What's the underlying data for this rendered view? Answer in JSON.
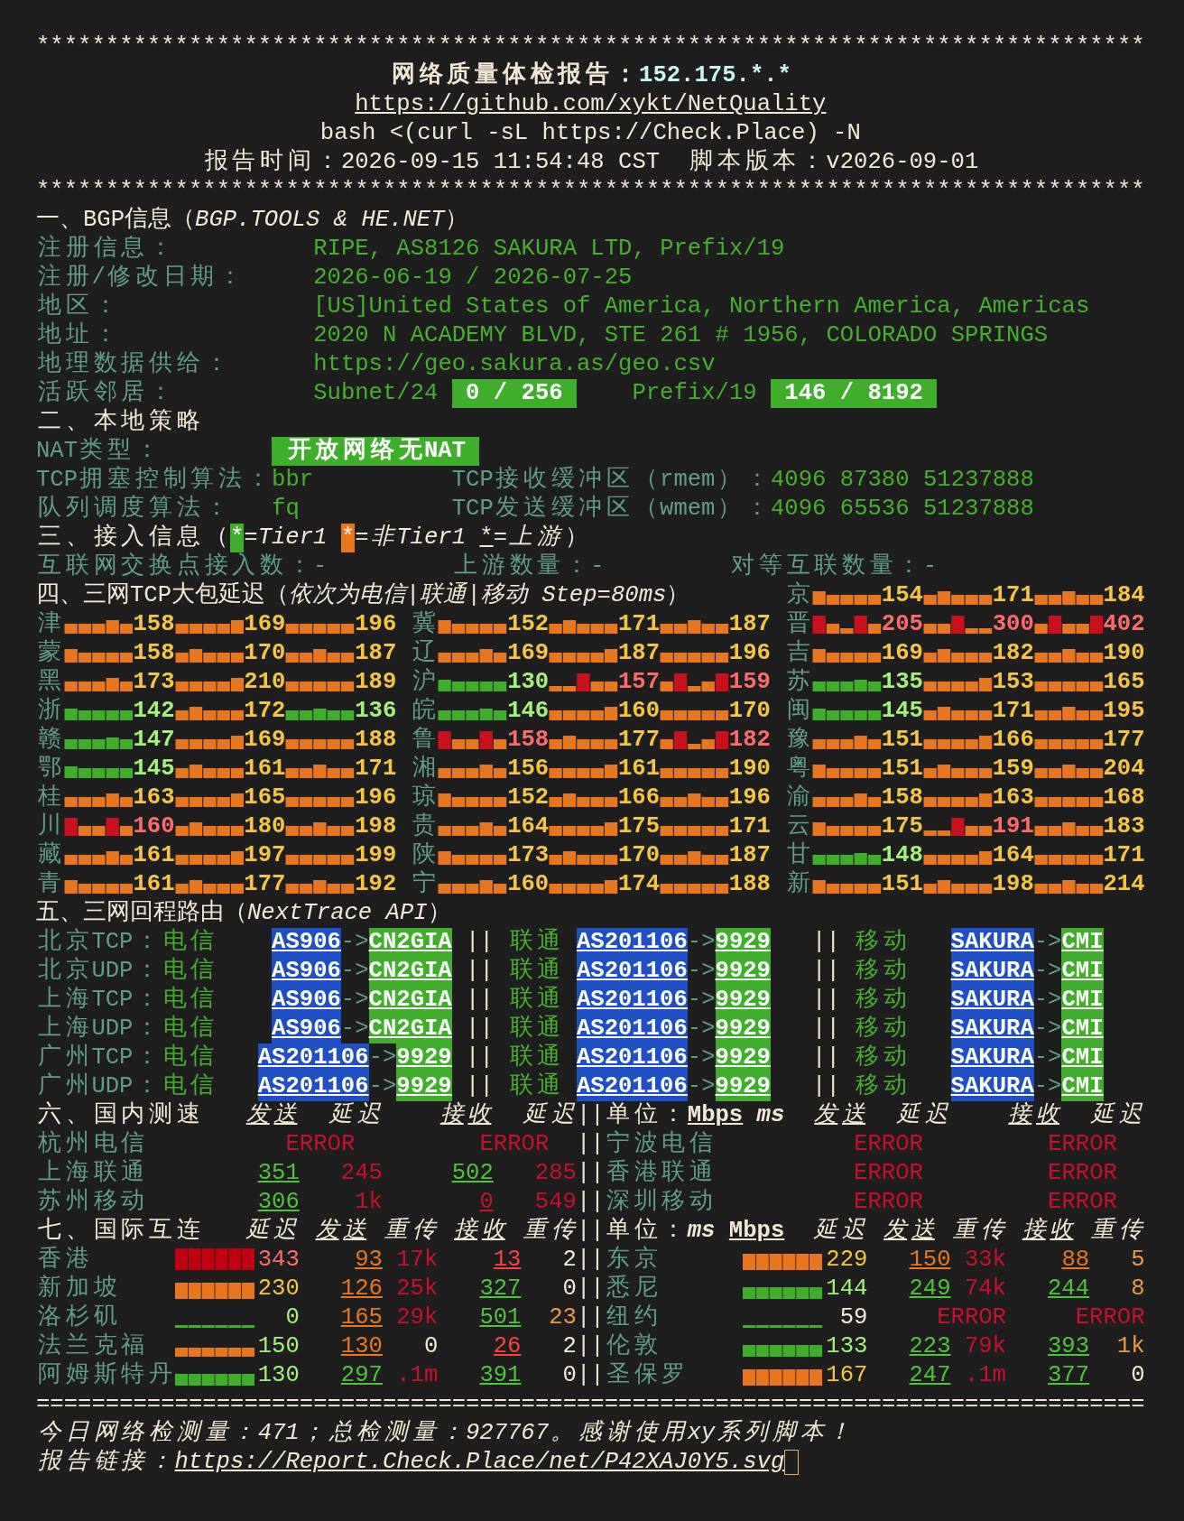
{
  "header": {
    "rule_top": "********************************************************************************",
    "title": "网络质量体检报告：",
    "ip": "152.175.*.*",
    "repo_link": "https://github.com/xykt/NetQuality",
    "command": "bash <(curl -sL https://Check.Place) -N",
    "time_label": "报告时间：",
    "time": "2026-09-15 11:54:48 CST",
    "version_label": "脚本版本：",
    "version": "v2026-09-01",
    "rule_bottom": "********************************************************************************"
  },
  "bgp": {
    "heading": "一、BGP信息（*BGP.TOOLS & HE.NET*）",
    "rows": [
      {
        "label": "注册信息：",
        "value": "RIPE, AS8126 SAKURA LTD, Prefix/19"
      },
      {
        "label": "注册/修改日期：",
        "value": "2026-06-19 / 2026-07-25"
      },
      {
        "label": "地区：",
        "value": "[US]United States of America, Northern America, Americas"
      },
      {
        "label": "地址：",
        "value": "2020 N ACADEMY BLVD, STE 261 # 1956, COLORADO SPRINGS"
      },
      {
        "label": "地理数据供给：",
        "value": "https://geo.sakura.as/geo.csv"
      }
    ],
    "neighbors": {
      "label": "活跃邻居：",
      "subnet_label": "Subnet/24",
      "subnet": "0 / 256",
      "prefix_label": "Prefix/19",
      "prefix": "146 / 8192"
    }
  },
  "local_policy": {
    "heading": "二、本地策略",
    "nat": {
      "label": "NAT类型：",
      "value": "开放网络无NAT"
    },
    "rows": [
      {
        "label": "TCP拥塞控制算法：",
        "value": "bbr",
        "buffer_label": "TCP接收缓冲区（rmem）：",
        "buffer": "4096 87380 51237888"
      },
      {
        "label": "队列调度算法：",
        "value": "fq",
        "buffer_label": "TCP发送缓冲区（wmem）：",
        "buffer": "4096 65536 51237888"
      }
    ]
  },
  "access": {
    "heading": "三、接入信息（",
    "legend": [
      {
        "marker": "*",
        "kind": "tier1",
        "text": "=Tier1"
      },
      {
        "marker": "*",
        "kind": "non_tier1",
        "text": "=非Tier1"
      },
      {
        "marker": "*",
        "kind": "upstream",
        "text": "=上游"
      }
    ],
    "heading_close": "）",
    "stats": [
      {
        "label": "互联网交换点接入数：",
        "value": "-"
      },
      {
        "label": "上游数量：",
        "value": "-"
      },
      {
        "label": "对等互联数量：",
        "value": "-"
      }
    ]
  },
  "latency": {
    "heading": "四、三网TCP大包延迟（*依次为电信|联通|移动 Step=80ms*）",
    "provinces": [
      {
        "name": "京",
        "paths": [
          {
            "text": "154",
            "color": "#f5c542",
            "kind": "normal"
          },
          {
            "text": "171",
            "color": "#f5c542",
            "kind": "normal"
          },
          {
            "text": "184",
            "color": "#f5c542",
            "kind": "normal"
          }
        ]
      },
      {
        "name": "津",
        "paths": [
          {
            "text": "158",
            "color": "#f5c542",
            "kind": "normal"
          },
          {
            "text": "169",
            "color": "#f5c542",
            "kind": "normal"
          },
          {
            "text": "196",
            "color": "#f5c542",
            "kind": "normal"
          }
        ]
      },
      {
        "name": "冀",
        "paths": [
          {
            "text": "152",
            "color": "#f5c542",
            "kind": "normal"
          },
          {
            "text": "171",
            "color": "#f5c542",
            "kind": "normal"
          },
          {
            "text": "187",
            "color": "#f5c542",
            "kind": "normal"
          }
        ]
      },
      {
        "name": "晋",
        "paths": [
          {
            "text": "205",
            "color": "#ff6b6b",
            "kind": "spiky"
          },
          {
            "text": "300",
            "color": "#ff6b6b",
            "kind": "spiky"
          },
          {
            "text": "402",
            "color": "#ff6b6b",
            "kind": "spiky"
          }
        ]
      },
      {
        "name": "蒙",
        "paths": [
          {
            "text": "158",
            "color": "#f5c542",
            "kind": "normal"
          },
          {
            "text": "170",
            "color": "#f5c542",
            "kind": "normal"
          },
          {
            "text": "187",
            "color": "#f5c542",
            "kind": "normal"
          }
        ]
      },
      {
        "name": "辽",
        "paths": [
          {
            "text": "169",
            "color": "#f5c542",
            "kind": "normal"
          },
          {
            "text": "187",
            "color": "#f5c542",
            "kind": "normal"
          },
          {
            "text": "196",
            "color": "#f5c542",
            "kind": "normal"
          }
        ]
      },
      {
        "name": "吉",
        "paths": [
          {
            "text": "169",
            "color": "#f5c542",
            "kind": "normal"
          },
          {
            "text": "182",
            "color": "#f5c542",
            "kind": "normal"
          },
          {
            "text": "190",
            "color": "#f5c542",
            "kind": "normal"
          }
        ]
      },
      {
        "name": "黑",
        "paths": [
          {
            "text": "173",
            "color": "#f5c542",
            "kind": "normal"
          },
          {
            "text": "210",
            "color": "#f5c542",
            "kind": "normal"
          },
          {
            "text": "189",
            "color": "#f5c542",
            "kind": "normal"
          }
        ]
      },
      {
        "name": "沪",
        "paths": [
          {
            "text": "130",
            "color": "#a3f07a",
            "kind": "good"
          },
          {
            "text": "157",
            "color": "#ff6b6b",
            "kind": "spiky"
          },
          {
            "text": "159",
            "color": "#ff6b6b",
            "kind": "spiky"
          }
        ]
      },
      {
        "name": "苏",
        "paths": [
          {
            "text": "135",
            "color": "#a3f07a",
            "kind": "good"
          },
          {
            "text": "153",
            "color": "#f5c542",
            "kind": "normal"
          },
          {
            "text": "165",
            "color": "#f5c542",
            "kind": "normal"
          }
        ]
      },
      {
        "name": "浙",
        "paths": [
          {
            "text": "142",
            "color": "#a3f07a",
            "kind": "good"
          },
          {
            "text": "172",
            "color": "#f5c542",
            "kind": "normal"
          },
          {
            "text": "136",
            "color": "#a3f07a",
            "kind": "good"
          }
        ]
      },
      {
        "name": "皖",
        "paths": [
          {
            "text": "146",
            "color": "#a3f07a",
            "kind": "good"
          },
          {
            "text": "160",
            "color": "#f5c542",
            "kind": "normal"
          },
          {
            "text": "170",
            "color": "#f5c542",
            "kind": "normal"
          }
        ]
      },
      {
        "name": "闽",
        "paths": [
          {
            "text": "145",
            "color": "#a3f07a",
            "kind": "good"
          },
          {
            "text": "171",
            "color": "#f5c542",
            "kind": "normal"
          },
          {
            "text": "195",
            "color": "#f5c542",
            "kind": "normal"
          }
        ]
      },
      {
        "name": "赣",
        "paths": [
          {
            "text": "147",
            "color": "#a3f07a",
            "kind": "good"
          },
          {
            "text": "169",
            "color": "#f5c542",
            "kind": "normal"
          },
          {
            "text": "188",
            "color": "#f5c542",
            "kind": "normal"
          }
        ]
      },
      {
        "name": "鲁",
        "paths": [
          {
            "text": "158",
            "color": "#ff6b6b",
            "kind": "spiky"
          },
          {
            "text": "177",
            "color": "#f5c542",
            "kind": "normal"
          },
          {
            "text": "182",
            "color": "#ff6b6b",
            "kind": "spiky"
          }
        ]
      },
      {
        "name": "豫",
        "paths": [
          {
            "text": "151",
            "color": "#f5c542",
            "kind": "normal"
          },
          {
            "text": "166",
            "color": "#f5c542",
            "kind": "normal"
          },
          {
            "text": "177",
            "color": "#f5c542",
            "kind": "normal"
          }
        ]
      },
      {
        "name": "鄂",
        "paths": [
          {
            "text": "145",
            "color": "#a3f07a",
            "kind": "good"
          },
          {
            "text": "161",
            "color": "#f5c542",
            "kind": "normal"
          },
          {
            "text": "171",
            "color": "#f5c542",
            "kind": "normal"
          }
        ]
      },
      {
        "name": "湘",
        "paths": [
          {
            "text": "156",
            "color": "#f5c542",
            "kind": "normal"
          },
          {
            "text": "161",
            "color": "#f5c542",
            "kind": "normal"
          },
          {
            "text": "190",
            "color": "#f5c542",
            "kind": "normal"
          }
        ]
      },
      {
        "name": "粤",
        "paths": [
          {
            "text": "151",
            "color": "#f5c542",
            "kind": "normal"
          },
          {
            "text": "159",
            "color": "#f5c542",
            "kind": "normal"
          },
          {
            "text": "204",
            "color": "#f5c542",
            "kind": "normal"
          }
        ]
      },
      {
        "name": "桂",
        "paths": [
          {
            "text": "163",
            "color": "#f5c542",
            "kind": "normal"
          },
          {
            "text": "165",
            "color": "#f5c542",
            "kind": "normal"
          },
          {
            "text": "196",
            "color": "#f5c542",
            "kind": "normal"
          }
        ]
      },
      {
        "name": "琼",
        "paths": [
          {
            "text": "152",
            "color": "#f5c542",
            "kind": "normal"
          },
          {
            "text": "166",
            "color": "#f5c542",
            "kind": "normal"
          },
          {
            "text": "196",
            "color": "#f5c542",
            "kind": "normal"
          }
        ]
      },
      {
        "name": "渝",
        "paths": [
          {
            "text": "158",
            "color": "#f5c542",
            "kind": "normal"
          },
          {
            "text": "163",
            "color": "#f5c542",
            "kind": "normal"
          },
          {
            "text": "168",
            "color": "#f5c542",
            "kind": "normal"
          }
        ]
      },
      {
        "name": "川",
        "paths": [
          {
            "text": "160",
            "color": "#ff6b6b",
            "kind": "spiky"
          },
          {
            "text": "180",
            "color": "#f5c542",
            "kind": "normal"
          },
          {
            "text": "198",
            "color": "#f5c542",
            "kind": "normal"
          }
        ]
      },
      {
        "name": "贵",
        "paths": [
          {
            "text": "164",
            "color": "#f5c542",
            "kind": "normal"
          },
          {
            "text": "175",
            "color": "#f5c542",
            "kind": "normal"
          },
          {
            "text": "171",
            "color": "#f5c542",
            "kind": "normal"
          }
        ]
      },
      {
        "name": "云",
        "paths": [
          {
            "text": "175",
            "color": "#f5c542",
            "kind": "normal"
          },
          {
            "text": "191",
            "color": "#ff6b6b",
            "kind": "spiky"
          },
          {
            "text": "183",
            "color": "#f5c542",
            "kind": "normal"
          }
        ]
      },
      {
        "name": "藏",
        "paths": [
          {
            "text": "161",
            "color": "#f5c542",
            "kind": "normal"
          },
          {
            "text": "197",
            "color": "#f5c542",
            "kind": "normal"
          },
          {
            "text": "199",
            "color": "#f5c542",
            "kind": "normal"
          }
        ]
      },
      {
        "name": "陕",
        "paths": [
          {
            "text": "173",
            "color": "#f5c542",
            "kind": "normal"
          },
          {
            "text": "170",
            "color": "#f5c542",
            "kind": "normal"
          },
          {
            "text": "187",
            "color": "#f5c542",
            "kind": "normal"
          }
        ]
      },
      {
        "name": "甘",
        "paths": [
          {
            "text": "148",
            "color": "#a3f07a",
            "kind": "good"
          },
          {
            "text": "164",
            "color": "#f5c542",
            "kind": "normal"
          },
          {
            "text": "171",
            "color": "#f5c542",
            "kind": "normal"
          }
        ]
      },
      {
        "name": "青",
        "paths": [
          {
            "text": "161",
            "color": "#f5c542",
            "kind": "normal"
          },
          {
            "text": "177",
            "color": "#f5c542",
            "kind": "normal"
          },
          {
            "text": "192",
            "color": "#f5c542",
            "kind": "normal"
          }
        ]
      },
      {
        "name": "宁",
        "paths": [
          {
            "text": "160",
            "color": "#f5c542",
            "kind": "normal"
          },
          {
            "text": "174",
            "color": "#f5c542",
            "kind": "normal"
          },
          {
            "text": "188",
            "color": "#f5c542",
            "kind": "normal"
          }
        ]
      },
      {
        "name": "新",
        "paths": [
          {
            "text": "151",
            "color": "#f5c542",
            "kind": "normal"
          },
          {
            "text": "198",
            "color": "#f5c542",
            "kind": "normal"
          },
          {
            "text": "214",
            "color": "#f5c542",
            "kind": "normal"
          }
        ]
      }
    ]
  },
  "routes": {
    "heading": "五、三网回程路由（*NextTrace API*）",
    "rows": [
      {
        "location": "北京TCP：",
        "isps": [
          {
            "name": "电信",
            "from": "AS906",
            "arrow": "->",
            "to": "CN2GIA"
          },
          {
            "separator": "||",
            "name": "联通",
            "from": "AS201106",
            "arrow": "->",
            "to": "9929"
          },
          {
            "separator": "||",
            "name": "移动",
            "from": "SAKURA",
            "arrow": "->",
            "to": "CMI"
          }
        ]
      },
      {
        "location": "北京UDP：",
        "isps": [
          {
            "name": "电信",
            "from": "AS906",
            "arrow": "->",
            "to": "CN2GIA"
          },
          {
            "separator": "||",
            "name": "联通",
            "from": "AS201106",
            "arrow": "->",
            "to": "9929"
          },
          {
            "separator": "||",
            "name": "移动",
            "from": "SAKURA",
            "arrow": "->",
            "to": "CMI"
          }
        ]
      },
      {
        "location": "上海TCP：",
        "isps": [
          {
            "name": "电信",
            "from": "AS906",
            "arrow": "->",
            "to": "CN2GIA"
          },
          {
            "separator": "||",
            "name": "联通",
            "from": "AS201106",
            "arrow": "->",
            "to": "9929"
          },
          {
            "separator": "||",
            "name": "移动",
            "from": "SAKURA",
            "arrow": "->",
            "to": "CMI"
          }
        ]
      },
      {
        "location": "上海UDP：",
        "isps": [
          {
            "name": "电信",
            "from": "AS906",
            "arrow": "->",
            "to": "CN2GIA"
          },
          {
            "separator": "||",
            "name": "联通",
            "from": "AS201106",
            "arrow": "->",
            "to": "9929"
          },
          {
            "separator": "||",
            "name": "移动",
            "from": "SAKURA",
            "arrow": "->",
            "to": "CMI"
          }
        ]
      },
      {
        "location": "广州TCP：",
        "isps": [
          {
            "name": "电信",
            "from": "AS201106",
            "arrow": "->",
            "to": "9929"
          },
          {
            "separator": "||",
            "name": "联通",
            "from": "AS201106",
            "arrow": "->",
            "to": "9929"
          },
          {
            "separator": "||",
            "name": "移动",
            "from": "SAKURA",
            "arrow": "->",
            "to": "CMI"
          }
        ]
      },
      {
        "location": "广州UDP：",
        "isps": [
          {
            "name": "电信",
            "from": "AS201106",
            "arrow": "->",
            "to": "9929"
          },
          {
            "separator": "||",
            "name": "联通",
            "from": "AS201106",
            "arrow": "->",
            "to": "9929"
          },
          {
            "separator": "||",
            "name": "移动",
            "from": "SAKURA",
            "arrow": "->",
            "to": "CMI"
          }
        ]
      }
    ]
  },
  "domestic": {
    "heading": "六、国内测速",
    "columns": [
      {
        "text": "发送",
        "kind": "rate"
      },
      {
        "text": "延迟",
        "kind": "delay"
      },
      {
        "text": "接收",
        "kind": "rate"
      },
      {
        "text": "延迟",
        "kind": "delay"
      }
    ],
    "separator": "||",
    "unit_label": "单位：",
    "units": [
      {
        "text": "Mbps",
        "kind": "rate"
      },
      {
        "text": "ms",
        "kind": "delay"
      }
    ],
    "right_columns": [
      {
        "text": "发送",
        "kind": "rate"
      },
      {
        "text": "延迟",
        "kind": "delay"
      },
      {
        "text": "接收",
        "kind": "rate"
      },
      {
        "text": "延迟",
        "kind": "delay"
      }
    ],
    "rows": [
      {
        "left": {
          "name": "杭州电信",
          "kind": "error",
          "errors": [
            "ERROR",
            "ERROR"
          ]
        },
        "separator": "||",
        "right": {
          "name": "宁波电信",
          "kind": "error",
          "errors": [
            "ERROR",
            "ERROR"
          ]
        }
      },
      {
        "left": {
          "name": "上海联通",
          "kind": "result",
          "send": {
            "text": "351",
            "color": "#4cc43a"
          },
          "send_latency": {
            "text": "245",
            "color": "#c8102e"
          },
          "recv": {
            "text": "502",
            "color": "#4cc43a"
          },
          "recv_latency": {
            "text": "285",
            "color": "#c8102e"
          }
        },
        "separator": "||",
        "right": {
          "name": "香港联通",
          "kind": "error",
          "errors": [
            "ERROR",
            "ERROR"
          ]
        }
      },
      {
        "left": {
          "name": "苏州移动",
          "kind": "result",
          "send": {
            "text": "306",
            "color": "#4cc43a"
          },
          "send_latency": {
            "text": "1k",
            "color": "#c8102e"
          },
          "recv": {
            "text": "0",
            "color": "#c8102e"
          },
          "recv_latency": {
            "text": "549",
            "color": "#c8102e"
          }
        },
        "separator": "||",
        "right": {
          "name": "深圳移动",
          "kind": "error",
          "errors": [
            "ERROR",
            "ERROR"
          ]
        }
      }
    ]
  },
  "international": {
    "heading": "七、国际互连",
    "columns": [
      {
        "text": "延迟",
        "kind": "delay"
      },
      {
        "text": "发送",
        "kind": "rate"
      },
      {
        "text": "重传",
        "kind": "delay"
      },
      {
        "text": "接收",
        "kind": "rate"
      },
      {
        "text": "重传",
        "kind": "delay"
      }
    ],
    "separator": "||",
    "unit_label": "单位：",
    "units": [
      {
        "text": "ms",
        "kind": "delay"
      },
      {
        "text": "Mbps",
        "kind": "rate"
      }
    ],
    "right_columns": [
      {
        "text": "延迟",
        "kind": "delay"
      },
      {
        "text": "发送",
        "kind": "rate"
      },
      {
        "text": "重传",
        "kind": "delay"
      },
      {
        "text": "接收",
        "kind": "rate"
      },
      {
        "text": "重传",
        "kind": "delay"
      }
    ],
    "rows": [
      {
        "left": {
          "name": "香港",
          "kind": "result",
          "bar": {
            "kind": "full",
            "color": "#c00010"
          },
          "latency": {
            "text": "343",
            "color": "#ff6b6b"
          },
          "send": {
            "text": "93",
            "color": "#e8761e"
          },
          "send_retrans": {
            "text": "17k",
            "color": "#c8102e"
          },
          "recv": {
            "text": "13",
            "color": "#ff4040"
          },
          "recv_retrans": {
            "text": "2",
            "color": "#f2e8d5"
          }
        },
        "separator": "||",
        "right": {
          "name": "东京",
          "kind": "result",
          "bar": {
            "kind": "high",
            "color": "#e8761e"
          },
          "latency": {
            "text": "229",
            "color": "#f5c542"
          },
          "send": {
            "text": "150",
            "color": "#e8761e"
          },
          "send_retrans": {
            "text": "33k",
            "color": "#c8102e"
          },
          "recv": {
            "text": "88",
            "color": "#e8761e"
          },
          "recv_retrans": {
            "text": "5",
            "color": "#e89a4a"
          }
        }
      },
      {
        "left": {
          "name": "新加坡",
          "kind": "result",
          "bar": {
            "kind": "high",
            "color": "#e8761e"
          },
          "latency": {
            "text": "230",
            "color": "#f5c542"
          },
          "send": {
            "text": "126",
            "color": "#e8761e"
          },
          "send_retrans": {
            "text": "25k",
            "color": "#c8102e"
          },
          "recv": {
            "text": "327",
            "color": "#4cc43a"
          },
          "recv_retrans": {
            "text": "0",
            "color": "#f2e8d5"
          }
        },
        "separator": "||",
        "right": {
          "name": "悉尼",
          "kind": "result",
          "bar": {
            "kind": "mid",
            "color": "#3fae2a"
          },
          "latency": {
            "text": "144",
            "color": "#a3f07a"
          },
          "send": {
            "text": "249",
            "color": "#4cc43a"
          },
          "send_retrans": {
            "text": "74k",
            "color": "#c8102e"
          },
          "recv": {
            "text": "244",
            "color": "#4cc43a"
          },
          "recv_retrans": {
            "text": "8",
            "color": "#e89a4a"
          }
        }
      },
      {
        "left": {
          "name": "洛杉矶",
          "kind": "result",
          "bar": {
            "kind": "flat",
            "color": "#3fae2a"
          },
          "latency": {
            "text": "0",
            "color": "#a3f07a"
          },
          "send": {
            "text": "165",
            "color": "#e8761e"
          },
          "send_retrans": {
            "text": "29k",
            "color": "#c8102e"
          },
          "recv": {
            "text": "501",
            "color": "#4cc43a"
          },
          "recv_retrans": {
            "text": "23",
            "color": "#e89a4a"
          }
        },
        "separator": "||",
        "right": {
          "name": "纽约",
          "kind": "error",
          "bar": {
            "kind": "flat",
            "color": "#3fae2a"
          },
          "latency": {
            "text": "59",
            "color": "#f2e8d5"
          },
          "errors": [
            "ERROR",
            "ERROR"
          ]
        }
      },
      {
        "left": {
          "name": "法兰克福",
          "kind": "result",
          "bar": {
            "kind": "low",
            "color": "#e8761e"
          },
          "latency": {
            "text": "150",
            "color": "#a3f07a"
          },
          "send": {
            "text": "130",
            "color": "#e8761e"
          },
          "send_retrans": {
            "text": "0",
            "color": "#f2e8d5"
          },
          "recv": {
            "text": "26",
            "color": "#ff4040"
          },
          "recv_retrans": {
            "text": "2",
            "color": "#f2e8d5"
          }
        },
        "separator": "||",
        "right": {
          "name": "伦敦",
          "kind": "result",
          "bar": {
            "kind": "mid",
            "color": "#3fae2a"
          },
          "latency": {
            "text": "133",
            "color": "#a3f07a"
          },
          "send": {
            "text": "223",
            "color": "#4cc43a"
          },
          "send_retrans": {
            "text": "79k",
            "color": "#c8102e"
          },
          "recv": {
            "text": "393",
            "color": "#4cc43a"
          },
          "recv_retrans": {
            "text": "1k",
            "color": "#e89a4a"
          }
        }
      },
      {
        "left": {
          "name": "阿姆斯特丹",
          "kind": "result",
          "bar": {
            "kind": "mid",
            "color": "#3fae2a"
          },
          "latency": {
            "text": "130",
            "color": "#a3f07a"
          },
          "send": {
            "text": "297",
            "color": "#4cc43a"
          },
          "send_retrans": {
            "text": ".1m",
            "color": "#c8102e"
          },
          "recv": {
            "text": "391",
            "color": "#4cc43a"
          },
          "recv_retrans": {
            "text": "0",
            "color": "#f2e8d5"
          }
        },
        "separator": "||",
        "right": {
          "name": "圣保罗",
          "kind": "result",
          "bar": {
            "kind": "high",
            "color": "#e8761e"
          },
          "latency": {
            "text": "167",
            "color": "#f5c542"
          },
          "send": {
            "text": "247",
            "color": "#4cc43a"
          },
          "send_retrans": {
            "text": ".1m",
            "color": "#c8102e"
          },
          "recv": {
            "text": "377",
            "color": "#4cc43a"
          },
          "recv_retrans": {
            "text": "0",
            "color": "#f2e8d5"
          }
        }
      }
    ]
  },
  "footer": {
    "rule": "================================================================================",
    "stats": "今日网络检测量：471；总检测量：927767。感谢使用xy系列脚本！",
    "report_label": "报告链接：",
    "report_link": "https://Report.Check.Place/net/P42XAJ0Y5.svg"
  }
}
